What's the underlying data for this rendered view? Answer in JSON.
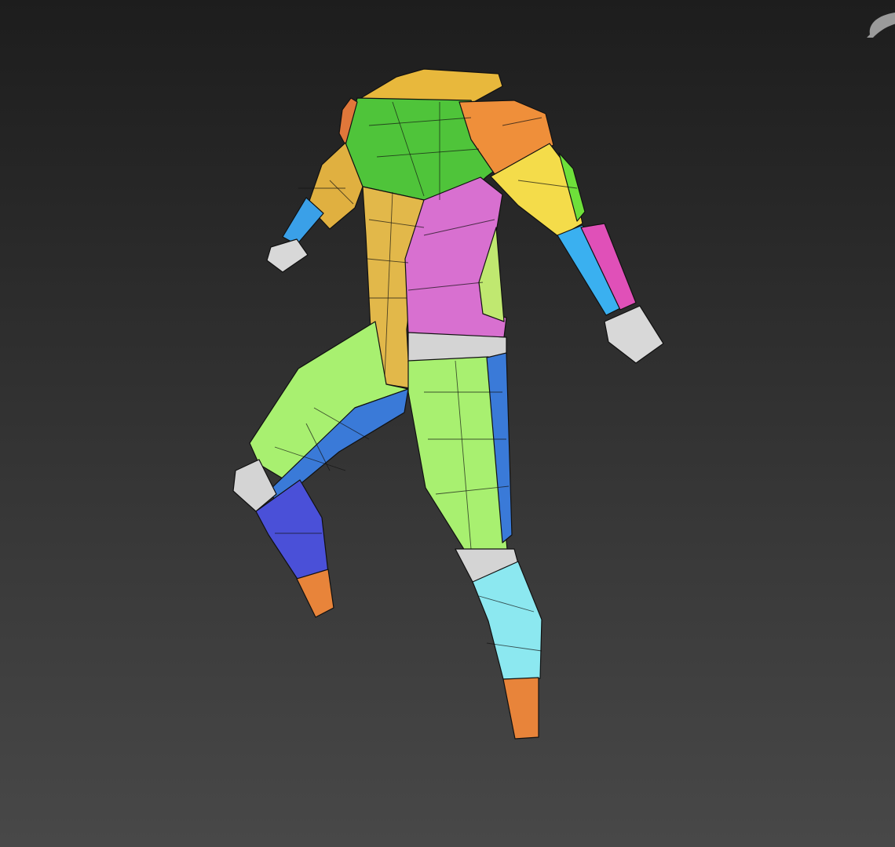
{
  "viewport": {
    "background_top": "#1d1d1d",
    "background_bottom": "#484848",
    "wire_color": "#111111"
  },
  "viewcube": {
    "ring_color": "#9a9a9a"
  },
  "mesh": {
    "colors": {
      "collar": "#e8b83c",
      "chest": "#4fc43a",
      "shoulder_r": "#ef8f3a",
      "shoulder_l": "#e0773a",
      "arm_l": "#e0b040",
      "forearm_l": "#3aa0e8",
      "hand": "#d8d8d8",
      "arm_r": "#f4dc4a",
      "arm_r_green": "#6ee03a",
      "forearm_r": "#3ab0f0",
      "forearm_r_pink": "#e050b8",
      "torso_l": "#e2b84a",
      "abdomen": "#d870d0",
      "abdomen_side": "#c0e870",
      "belt": "#d4d4d4",
      "thigh_l": "#a8f070",
      "thigh_l_under": "#3a7ad8",
      "knee": "#d4d4d4",
      "shin_l": "#4a50d8",
      "foot": "#e8843a",
      "thigh_r": "#a8f070",
      "thigh_r_side": "#3a7ad8",
      "shin_r": "#8ce8f0"
    }
  }
}
